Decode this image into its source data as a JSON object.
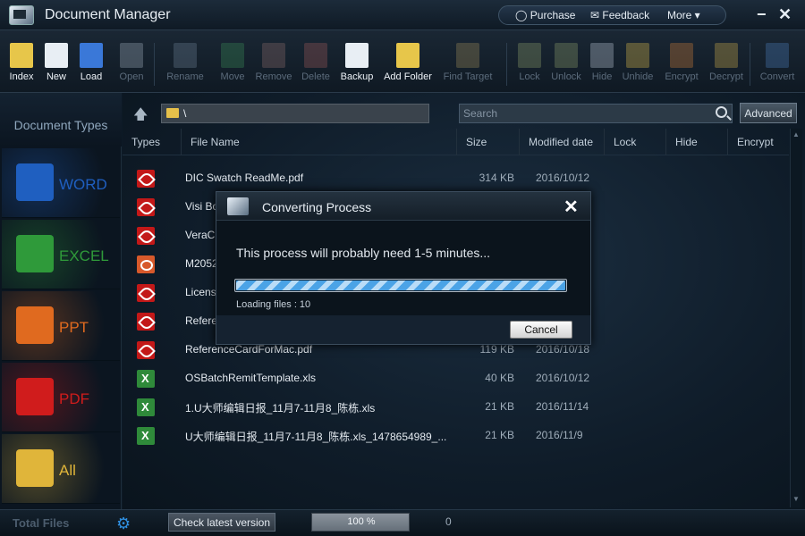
{
  "app": {
    "title": "Document Manager"
  },
  "topmenu": {
    "purchase": "Purchase",
    "feedback": "Feedback",
    "more": "More ▾"
  },
  "window": {
    "minimize": "−",
    "close": "✕"
  },
  "toolbar": [
    {
      "label": "Index",
      "icon": "index-icon",
      "enabled": true
    },
    {
      "label": "New",
      "icon": "new-doc-icon",
      "enabled": true
    },
    {
      "label": "Load",
      "icon": "load-icon",
      "enabled": true
    },
    {
      "label": "Open",
      "icon": "open-icon",
      "enabled": false
    },
    {
      "label": "Rename",
      "icon": "rename-icon",
      "enabled": false
    },
    {
      "label": "Move",
      "icon": "move-icon",
      "enabled": false
    },
    {
      "label": "Remove",
      "icon": "remove-icon",
      "enabled": false
    },
    {
      "label": "Delete",
      "icon": "delete-icon",
      "enabled": false
    },
    {
      "label": "Backup",
      "icon": "backup-icon",
      "enabled": true
    },
    {
      "label": "Add Folder",
      "icon": "add-folder-icon",
      "enabled": true
    },
    {
      "label": "Find Target",
      "icon": "find-target-icon",
      "enabled": false
    },
    {
      "label": "Lock",
      "icon": "lock-icon",
      "enabled": false
    },
    {
      "label": "Unlock",
      "icon": "unlock-icon",
      "enabled": false
    },
    {
      "label": "Hide",
      "icon": "hide-icon",
      "enabled": false
    },
    {
      "label": "Unhide",
      "icon": "unhide-icon",
      "enabled": false
    },
    {
      "label": "Encrypt",
      "icon": "encrypt-icon",
      "enabled": false
    },
    {
      "label": "Decrypt",
      "icon": "decrypt-icon",
      "enabled": false
    },
    {
      "label": "Convert",
      "icon": "convert-icon",
      "enabled": false
    }
  ],
  "sidebar": {
    "title": "Document Types",
    "categories": [
      {
        "label": "WORD",
        "color": "#1f5fc0",
        "icon": "word-icon"
      },
      {
        "label": "EXCEL",
        "color": "#2f9a3a",
        "icon": "excel-icon"
      },
      {
        "label": "PPT",
        "color": "#e06a1f",
        "icon": "ppt-icon"
      },
      {
        "label": "PDF",
        "color": "#d01c1c",
        "icon": "pdf-icon"
      },
      {
        "label": "All",
        "color": "#e0b53a",
        "icon": "folder-icon"
      }
    ]
  },
  "pathbar": {
    "path": "\\",
    "search_placeholder": "Search",
    "advanced": "Advanced"
  },
  "columns": [
    "Types",
    "File Name",
    "Size",
    "Modified date",
    "Lock",
    "Hide",
    "Encrypt"
  ],
  "files": [
    {
      "type": "pdf",
      "name": "DIC Swatch ReadMe.pdf",
      "size": "314 KB",
      "date": "2016/10/12"
    },
    {
      "type": "pdf",
      "name": "Visi Bo",
      "size": "",
      "date": "2"
    },
    {
      "type": "pdf",
      "name": "VeraC",
      "size": "",
      "date": "5"
    },
    {
      "type": "ppt",
      "name": "M2052",
      "size": "",
      "date": ""
    },
    {
      "type": "pdf",
      "name": "Licens",
      "size": "",
      "date": ""
    },
    {
      "type": "pdf",
      "name": "Refere",
      "size": "",
      "date": "8"
    },
    {
      "type": "pdf",
      "name": "ReferenceCardForMac.pdf",
      "size": "119 KB",
      "date": "2016/10/18"
    },
    {
      "type": "xls",
      "name": "OSBatchRemitTemplate.xls",
      "size": "40 KB",
      "date": "2016/10/12"
    },
    {
      "type": "xls",
      "name": "1.U大师编辑日报_11月7-11月8_陈栋.xls",
      "size": "21 KB",
      "date": "2016/11/14"
    },
    {
      "type": "xls",
      "name": "U大师编辑日报_11月7-11月8_陈栋.xls_1478654989_...",
      "size": "21 KB",
      "date": "2016/11/9"
    }
  ],
  "statusbar": {
    "total_files": "Total Files",
    "check_latest": "Check latest version",
    "progress_text": "100 %",
    "progress": 1.0,
    "count": "0"
  },
  "modal": {
    "title": "Converting Process",
    "close": "✕",
    "message": "This process will probably need 1-5 minutes...",
    "progress": 1.0,
    "loading": "Loading files :  10",
    "cancel": "Cancel"
  }
}
